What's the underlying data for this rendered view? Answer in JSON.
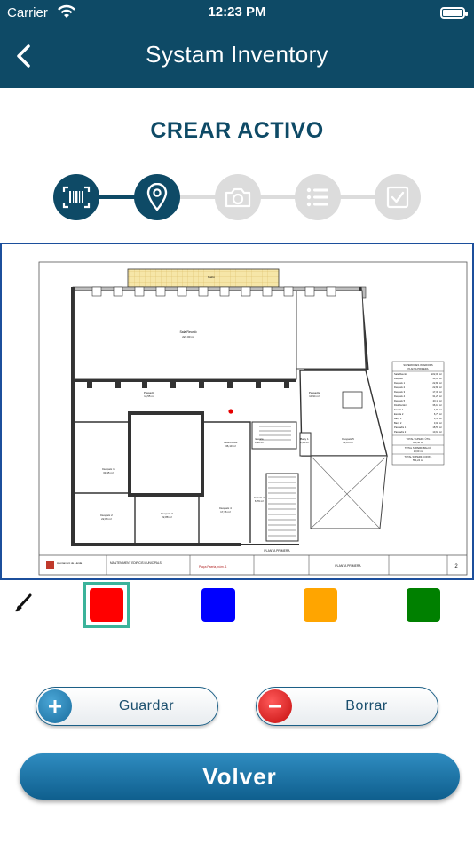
{
  "status_bar": {
    "carrier": "Carrier",
    "time": "12:23 PM"
  },
  "nav": {
    "title": "Systam Inventory",
    "back_icon": "chevron-left-icon"
  },
  "page_title": "CREAR ACTIVO",
  "stepper": {
    "steps": [
      {
        "icon": "barcode-icon",
        "state": "active"
      },
      {
        "icon": "location-pin-icon",
        "state": "active"
      },
      {
        "icon": "camera-icon",
        "state": "inactive"
      },
      {
        "icon": "list-icon",
        "state": "inactive"
      },
      {
        "icon": "checkbox-icon",
        "state": "inactive"
      }
    ],
    "active_color": "#0e4a66",
    "inactive_color": "#dcdcdc"
  },
  "floor_plan": {
    "main_hall": "Sala Reunió",
    "main_hall_area": "222,00 m²",
    "plan_label": "PLANTA PRIMERA",
    "sheet_label": "PLANTA PRIMERA",
    "municipality": "Ajuntament de Lleida",
    "project": "MANTENIMENT EDIFICIS MUNICIPALS",
    "address": "Plaça Paeria, núm. 1",
    "sheet_number": "2",
    "rooms": [
      {
        "name": "Passadís",
        "area": "18,55 m²"
      },
      {
        "name": "Passadís",
        "area": "10,94 m²"
      },
      {
        "name": "Distribuïdor",
        "area": "36,10 m²"
      },
      {
        "name": "Escala",
        "area": "4,98 m²"
      },
      {
        "name": "Bany 1",
        "area": "3,54 m²"
      },
      {
        "name": "Despatx 1",
        "area": "33,95 m²"
      },
      {
        "name": "Despatx 2",
        "area": "22,88 m²"
      },
      {
        "name": "Despatx 3",
        "area": "22,88 m²"
      },
      {
        "name": "Despatx 4",
        "area": "17,36 m²"
      },
      {
        "name": "Despatx 5",
        "area": "31,25 m²"
      },
      {
        "name": "Escala 2",
        "area": "6,79 m²"
      }
    ],
    "table_title": "SUPERFICIES INTERIORS",
    "table_subtitle": "PLANTA PRIMERA",
    "table_rows": [
      [
        "Sala Reunió",
        "222,00 m²"
      ],
      [
        "Despatx",
        "33,95 m²"
      ],
      [
        "Despatx 1",
        "22,88 m²"
      ],
      [
        "Despatx 2",
        "22,88 m²"
      ],
      [
        "Despatx 3",
        "17,36 m²"
      ],
      [
        "Despatx 4",
        "31,25 m²"
      ],
      [
        "Despatx 5",
        "20,11 m²"
      ],
      [
        "Distribuïdor",
        "36,10 m²"
      ],
      [
        "Escala 1",
        "4,98 m²"
      ],
      [
        "Escala 2",
        "6,79 m²"
      ],
      [
        "Bany 1",
        "3,54 m²"
      ],
      [
        "Bany 2",
        "3,08 m²"
      ],
      [
        "Passadís 1",
        "18,55 m²"
      ],
      [
        "Passadís 2",
        "10,94 m²"
      ]
    ],
    "totals": [
      [
        "TOTAL SUPERF. ÚTIL",
        "453,40 m²"
      ],
      [
        "TOTAL SUPERF. BALCÓ",
        "18,60 m²"
      ],
      [
        "TOTAL SUPERF. CONST.",
        "554,24 m²"
      ]
    ],
    "marker_color": "#e60000"
  },
  "palette": {
    "brush_icon": "brush-icon",
    "colors": [
      "#ff0000",
      "#0000ff",
      "#ffa500",
      "#008000"
    ],
    "selected_index": 0,
    "selected_border": "#3bb39a"
  },
  "actions": {
    "save_label": "Guardar",
    "save_icon": "plus-icon",
    "delete_label": "Borrar",
    "delete_icon": "minus-icon",
    "back_label": "Volver"
  }
}
